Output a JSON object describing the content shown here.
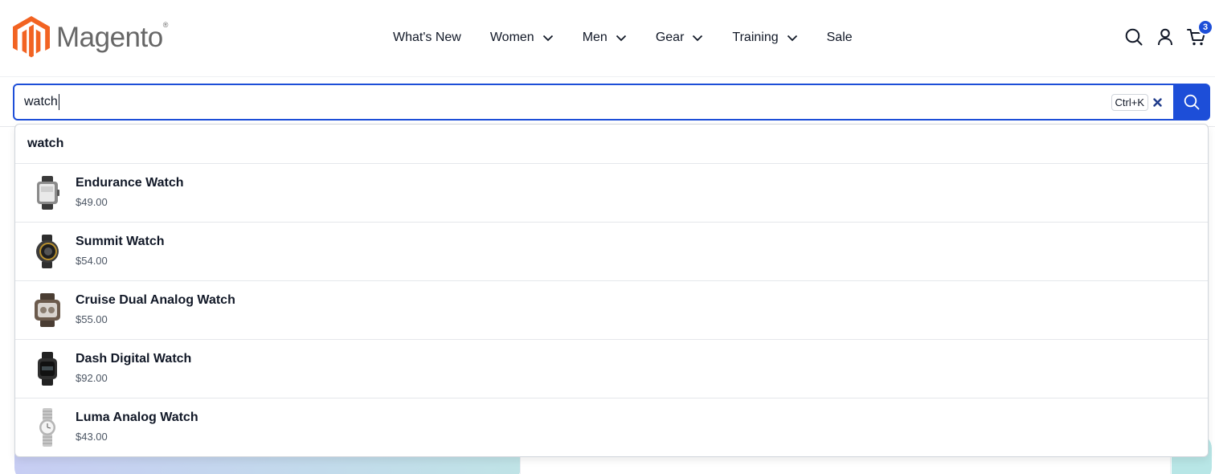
{
  "brand": {
    "name": "Magento",
    "reg_mark": "®",
    "logo_color": "#f26322"
  },
  "nav": {
    "items": [
      {
        "label": "What's New",
        "has_dropdown": false
      },
      {
        "label": "Women",
        "has_dropdown": true
      },
      {
        "label": "Men",
        "has_dropdown": true
      },
      {
        "label": "Gear",
        "has_dropdown": true
      },
      {
        "label": "Training",
        "has_dropdown": true
      },
      {
        "label": "Sale",
        "has_dropdown": false
      }
    ]
  },
  "header_icons": {
    "search": "search-icon",
    "account": "user-icon",
    "cart": "cart-icon",
    "cart_count": "3"
  },
  "search": {
    "value": "watch",
    "shortcut": "Ctrl+K",
    "clear_icon": "close-icon",
    "submit_icon": "search-icon",
    "accent_color": "#1d4ed8"
  },
  "suggestions": {
    "term": "watch",
    "products": [
      {
        "name": "Endurance Watch",
        "price": "$49.00"
      },
      {
        "name": "Summit Watch",
        "price": "$54.00"
      },
      {
        "name": "Cruise Dual Analog Watch",
        "price": "$55.00"
      },
      {
        "name": "Dash Digital Watch",
        "price": "$92.00"
      },
      {
        "name": "Luma Analog Watch",
        "price": "$43.00"
      }
    ]
  }
}
